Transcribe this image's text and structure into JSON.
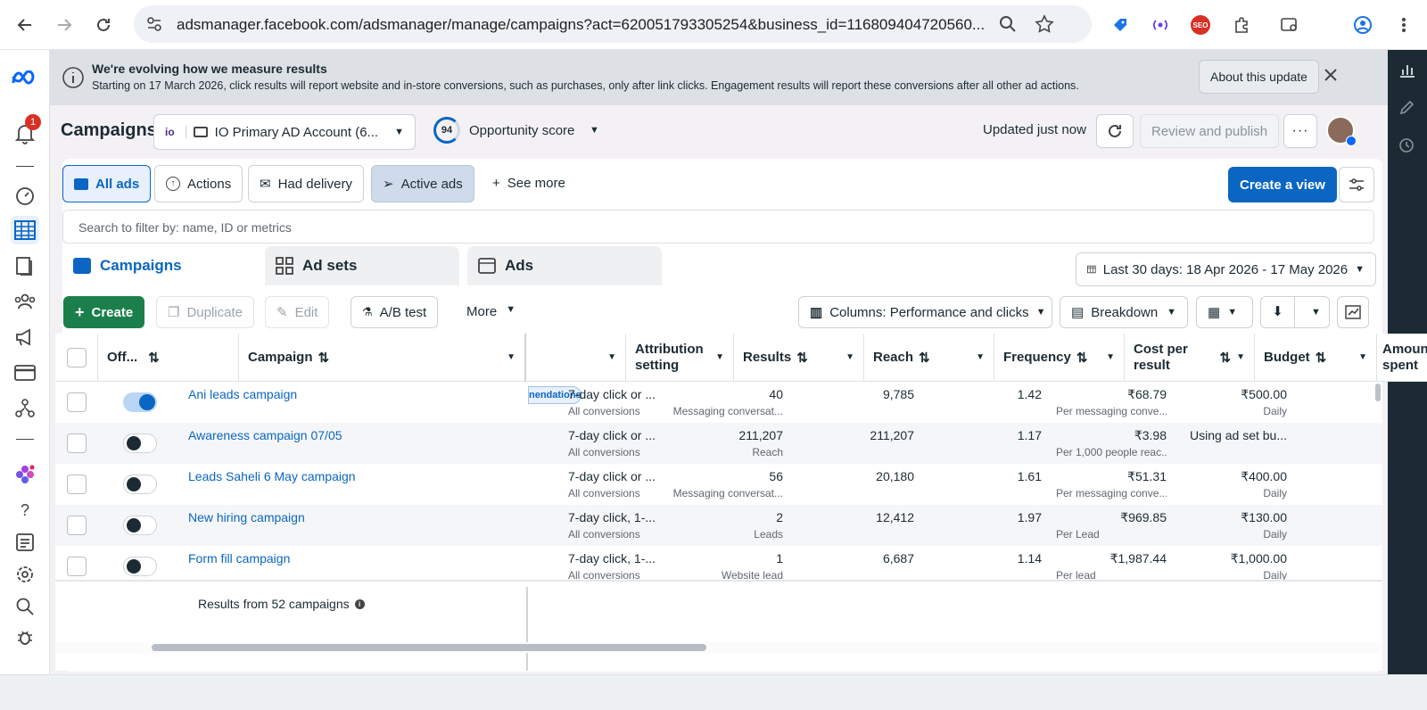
{
  "browser": {
    "url": "adsmanager.facebook.com/adsmanager/manage/campaigns?act=620051793305254&business_id=116809404720560..."
  },
  "rail": {
    "notification_count": "1"
  },
  "banner": {
    "title": "We're evolving how we measure results",
    "text": "Starting on 17 March 2026, click results will report website and in-store conversions, such as purchases, only after link clicks. Engagement results will report these conversions after all other ad actions.",
    "about_button": "About this update"
  },
  "header": {
    "title": "Campaigns",
    "account": "IO Primary AD Account (6...",
    "opportunity_score": "94",
    "opportunity_label": "Opportunity score",
    "updated": "Updated just now",
    "review_publish": "Review and publish"
  },
  "views": {
    "all_ads": "All ads",
    "actions": "Actions",
    "had_delivery": "Had delivery",
    "active_ads": "Active ads",
    "see_more": "See more",
    "create_view": "Create a view"
  },
  "search": {
    "placeholder": "Search to filter by: name, ID or metrics"
  },
  "tabs": {
    "campaigns": "Campaigns",
    "ad_sets": "Ad sets",
    "ads": "Ads",
    "date_range": "Last 30 days: 18 Apr 2026 - 17 May 2026"
  },
  "toolbar": {
    "create": "Create",
    "duplicate": "Duplicate",
    "edit": "Edit",
    "ab_test": "A/B test",
    "more": "More",
    "columns": "Columns: Performance and clicks",
    "breakdown": "Breakdown"
  },
  "table": {
    "headers": {
      "off": "Off...",
      "campaign": "Campaign",
      "attribution": "Attribution setting",
      "results": "Results",
      "reach": "Reach",
      "frequency": "Frequency",
      "cpr": "Cost per result",
      "budget": "Budget",
      "amount": "Amount spent"
    },
    "rows": [
      {
        "name": "Ani leads campaign",
        "on": true,
        "badge": "nendations",
        "attr": "7-day click or ...",
        "attr_sub": "All conversions",
        "results": "40",
        "results_sub": "Messaging conversat...",
        "reach": "9,785",
        "frequency": "1.42",
        "cpr": "₹68.79",
        "cpr_sub": "Per messaging conve...",
        "budget": "₹500.00",
        "budget_sub": "Daily"
      },
      {
        "name": "Awareness campaign 07/05",
        "on": false,
        "badge": "",
        "attr": "7-day click or ...",
        "attr_sub": "All conversions",
        "results": "211,207",
        "results_sub": "Reach",
        "reach": "211,207",
        "frequency": "1.17",
        "cpr": "₹3.98",
        "cpr_sub": "Per 1,000 people reac...",
        "budget": "Using ad set bu...",
        "budget_sub": ""
      },
      {
        "name": "Leads Saheli 6 May campaign",
        "on": false,
        "badge": "",
        "attr": "7-day click or ...",
        "attr_sub": "All conversions",
        "results": "56",
        "results_sub": "Messaging conversat...",
        "reach": "20,180",
        "frequency": "1.61",
        "cpr": "₹51.31",
        "cpr_sub": "Per messaging conve...",
        "budget": "₹400.00",
        "budget_sub": "Daily"
      },
      {
        "name": "New hiring campaign",
        "on": false,
        "badge": "",
        "attr": "7-day click, 1-...",
        "attr_sub": "All conversions",
        "results": "2",
        "results_sub": "Leads",
        "reach": "12,412",
        "frequency": "1.97",
        "cpr": "₹969.85",
        "cpr_sub": "Per Lead",
        "budget": "₹130.00",
        "budget_sub": "Daily"
      },
      {
        "name": "Form fill campaign",
        "on": false,
        "badge": "",
        "attr": "7-day click, 1-...",
        "attr_sub": "All conversions",
        "results": "1",
        "results_sub": "Website lead",
        "reach": "6,687",
        "frequency": "1.14",
        "cpr": "₹1,987.44",
        "cpr_sub": "Per lead",
        "budget": "₹1,000.00",
        "budget_sub": "Daily"
      }
    ],
    "footer": "Results from 52 campaigns"
  },
  "colors": {
    "brand_blue": "#0a66c2",
    "create_green": "#1a7f4b",
    "rail_dark": "#1c2b33"
  }
}
